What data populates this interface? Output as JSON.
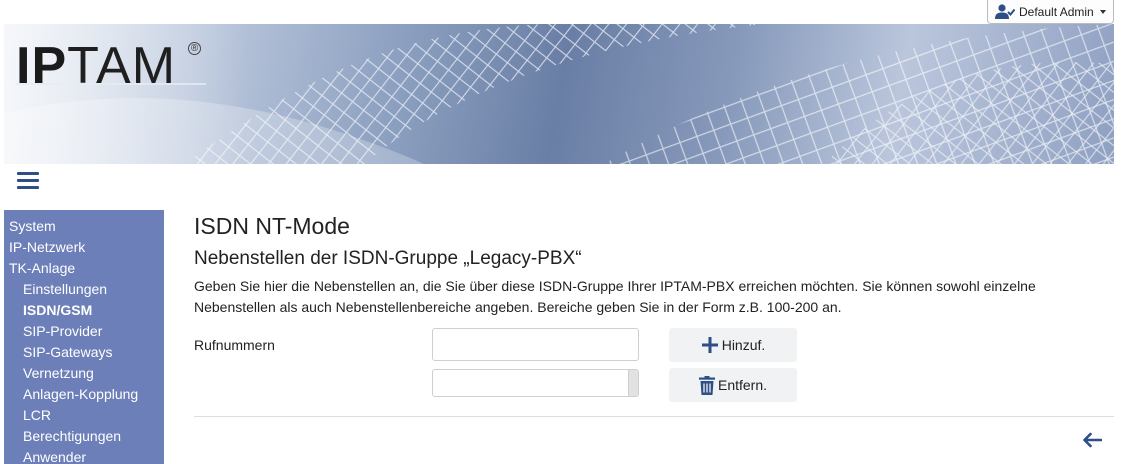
{
  "user_menu": {
    "label": "Default Admin",
    "icon": "user-check-icon"
  },
  "banner": {
    "logo_text_bold": "IP",
    "logo_text_light": "TAM",
    "logo_reg": "®"
  },
  "menu_icon": "hamburger-icon",
  "sidebar": {
    "items": [
      {
        "label": "System",
        "level": 0,
        "active": false
      },
      {
        "label": "IP-Netzwerk",
        "level": 0,
        "active": false
      },
      {
        "label": "TK-Anlage",
        "level": 0,
        "active": false
      },
      {
        "label": "Einstellungen",
        "level": 1,
        "active": false
      },
      {
        "label": "ISDN/GSM",
        "level": 1,
        "active": true
      },
      {
        "label": "SIP-Provider",
        "level": 1,
        "active": false
      },
      {
        "label": "SIP-Gateways",
        "level": 1,
        "active": false
      },
      {
        "label": "Vernetzung",
        "level": 1,
        "active": false
      },
      {
        "label": "Anlagen-Kopplung",
        "level": 1,
        "active": false
      },
      {
        "label": "LCR",
        "level": 1,
        "active": false
      },
      {
        "label": "Berechtigungen",
        "level": 1,
        "active": false
      },
      {
        "label": "Anwender",
        "level": 1,
        "active": false
      }
    ]
  },
  "main": {
    "title": "ISDN NT-Mode",
    "section_title": "Nebenstellen der ISDN-Gruppe „Legacy-PBX“",
    "description": "Geben Sie hier die Nebenstellen an, die Sie über diese ISDN-Gruppe Ihrer IPTAM-PBX erreichen möchten. Sie können sowohl einzelne Nebenstellen als auch Nebenstellenbereiche angeben. Bereiche geben Sie in der Form z.B. 100-200 an.",
    "form": {
      "label": "Rufnummern",
      "input_value": "",
      "add_button": "Hinzuf.",
      "remove_button": "Entfern."
    },
    "back_icon": "arrow-left-icon"
  },
  "colors": {
    "sidebar_bg": "#6c7fb8",
    "accent": "#2d4f86",
    "button_bg": "#f1f2f4"
  }
}
